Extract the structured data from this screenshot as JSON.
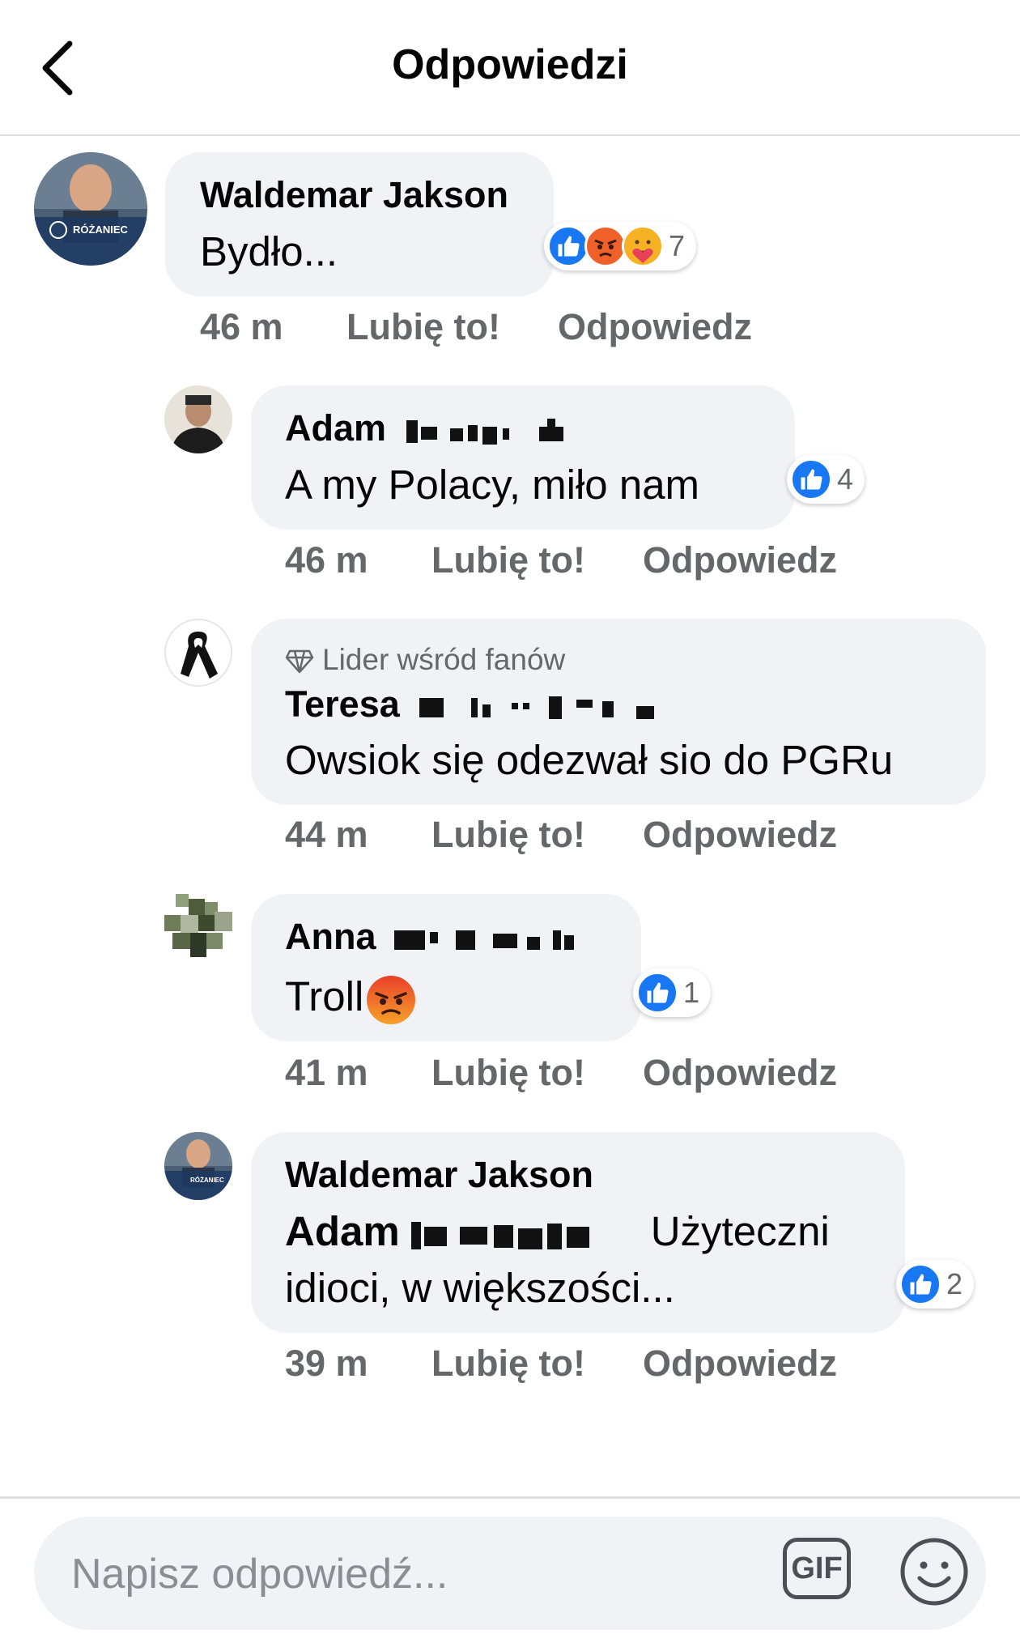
{
  "header": {
    "title": "Odpowiedzi"
  },
  "comments": [
    {
      "author": "Waldemar Jakson",
      "text": "Bydło...",
      "reaction_count": "7",
      "time": "46 m",
      "like_label": "Lubię to!",
      "reply_label": "Odpowiedz",
      "avatar_caption": "RÓŻANIEC"
    },
    {
      "author": "Adam",
      "text": "A my Polacy, miło nam",
      "reaction_count": "4",
      "time": "46 m",
      "like_label": "Lubię to!",
      "reply_label": "Odpowiedz"
    },
    {
      "badge": "Lider wśród fanów",
      "author": "Teresa",
      "text": "Owsiok się odezwał sio do PGRu",
      "time": "44 m",
      "like_label": "Lubię to!",
      "reply_label": "Odpowiedz"
    },
    {
      "author": "Anna",
      "text": "Troll",
      "reaction_count": "1",
      "time": "41 m",
      "like_label": "Lubię to!",
      "reply_label": "Odpowiedz"
    },
    {
      "author": "Waldemar Jakson",
      "mention": "Adam",
      "text_line1": "Użyteczni",
      "text_line2": "idioci, w większości...",
      "reaction_count": "2",
      "time": "39 m",
      "like_label": "Lubię to!",
      "reply_label": "Odpowiedz",
      "avatar_caption": "RÓŻANIEC"
    }
  ],
  "composer": {
    "placeholder": "Napisz odpowiedź...",
    "gif_label": "GIF"
  },
  "icons": {
    "back": "chevron-left-icon",
    "like": "like-reaction-icon",
    "angry": "angry-reaction-icon",
    "care": "care-reaction-icon",
    "emoji": "smiley-icon",
    "badge": "diamond-icon"
  },
  "colors": {
    "like_blue": "#1877f2",
    "angry_orange": "#f0612a",
    "care_yellow": "#f7b125",
    "bubble_bg": "#f0f2f5",
    "meta_gray": "#65676b"
  }
}
